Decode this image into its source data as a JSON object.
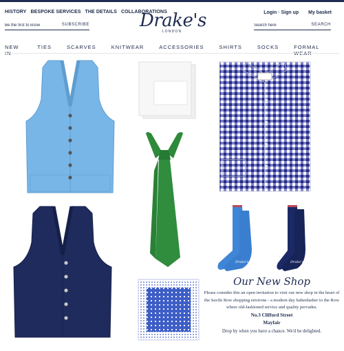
{
  "header": {
    "top_links": [
      "HISTORY",
      "BESPOKE SERVICES",
      "THE DETAILS",
      "COLLABORATIONS"
    ],
    "account": {
      "login": "Login · Sign up",
      "basket": "My basket"
    },
    "logo": {
      "brand": "Drake's",
      "city": "LONDON"
    },
    "newsletter": {
      "placeholder": "Be the first to know",
      "button": "SUBSCRIBE"
    },
    "search": {
      "placeholder": "Search here",
      "button": "SEARCH"
    }
  },
  "nav": {
    "items": [
      "NEW IN",
      "TIES",
      "SCARVES",
      "KNITWEAR",
      "ACCESSORIES",
      "SHIRTS",
      "SOCKS",
      "FORMAL WEAR"
    ]
  },
  "products": {
    "light_blue_vest": {
      "icon": "sweater-vest-icon",
      "color": "#76b4e6"
    },
    "navy_vest": {
      "icon": "sweater-vest-icon",
      "color": "#1d2a5a"
    },
    "white_pocket_square": {
      "icon": "pocket-square-icon",
      "color": "#f2f2f2"
    },
    "green_tie": {
      "icon": "tie-icon",
      "color": "#2f8b3c"
    },
    "gingham_shirt": {
      "icon": "shirt-icon",
      "color": "#2a2f86"
    },
    "blue_socks": {
      "icon": "sock-icon",
      "color": "#3f86d6"
    },
    "navy_socks": {
      "icon": "sock-icon",
      "color": "#1b2a66"
    },
    "blue_pocket_square": {
      "icon": "pocket-square-icon",
      "color": "#3b5cc4"
    }
  },
  "promo": {
    "title": "Our New Shop",
    "body": "Please consider this an open invitation to visit our new shop in the heart of the Savile Row shopping environs - a modern day haberdasher to the Row where old-fashioned service and quality pervades.",
    "address_line1": "No.3 Clifford Street",
    "address_line2": "Mayfair",
    "cta": "Drop by when you have a chance. We'd be delighted."
  }
}
